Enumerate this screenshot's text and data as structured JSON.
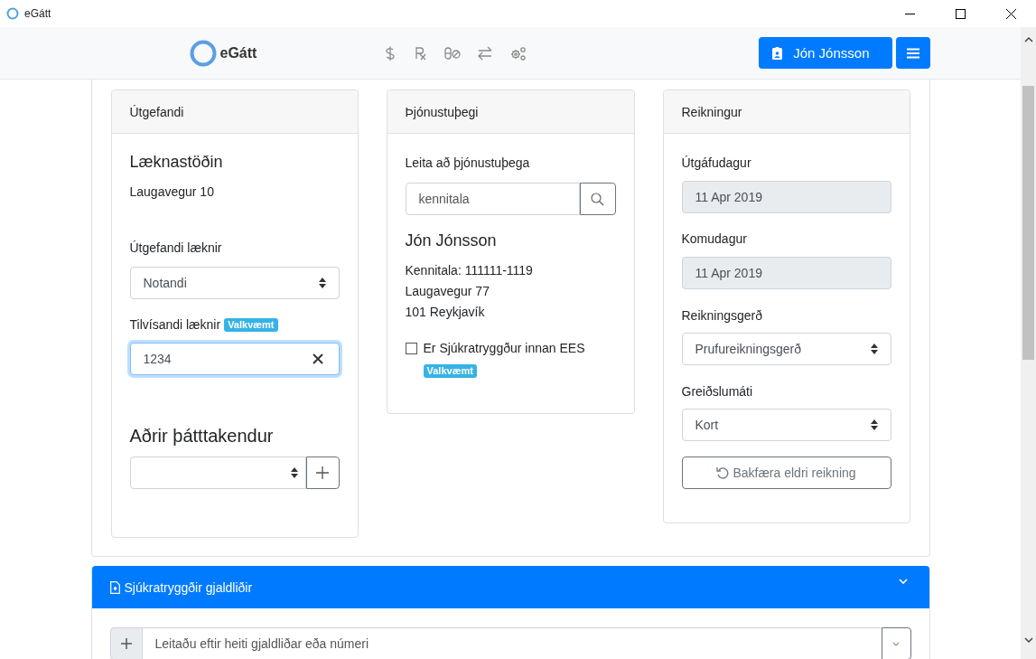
{
  "window": {
    "title": "eGátt"
  },
  "navbar": {
    "brand": "eGátt",
    "user_button": "Jón Jónsson"
  },
  "issuer": {
    "header": "Útgefandi",
    "clinic": "Læknastöðin",
    "address": "Laugavegur 10",
    "doctor_label": "Útgefandi læknir",
    "doctor_value": "Notandi",
    "referring_label": "Tilvísandi læknir",
    "referring_badge": "Valkvæmt",
    "referring_value": "1234",
    "referring_focused": true,
    "participants_heading": "Aðrir þátttakendur"
  },
  "recipient": {
    "header": "Þjónustuþegi",
    "search_label": "Leita að þjónustuþega",
    "search_placeholder": "kennitala",
    "name": "Jón Jónsson",
    "lines": [
      "Kennitala: 111111-1119",
      "Laugavegur 77",
      "101 Reykjavík"
    ],
    "ees_label": "Er Sjúkratryggður innan EES",
    "ees_checked": false,
    "ees_badge": "Valkvæmt"
  },
  "invoice": {
    "header": "Reikningur",
    "fields": [
      {
        "kind": "date",
        "label": "Útgáfudagur",
        "value": "11 Apr 2019"
      },
      {
        "kind": "date",
        "label": "Komudagur",
        "value": "11 Apr 2019"
      },
      {
        "kind": "select",
        "label": "Reikningsgerð",
        "value": "Prufureikningsgerð"
      },
      {
        "kind": "select",
        "label": "Greiðslumáti",
        "value": "Kort"
      }
    ],
    "reverse_button": "Bakfæra eldri reikning"
  },
  "items_panel": {
    "title": "Sjúkratryggðir gjaldliðir",
    "expanded": true,
    "search_placeholder": "Leitaðu eftir heiti gjaldliðar eða númeri"
  }
}
